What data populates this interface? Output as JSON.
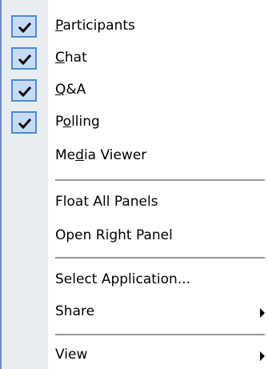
{
  "menu": {
    "colors": {
      "gutter": "#e9ecf1",
      "gutter_edge": "#6d92bd",
      "check_fill": "#c6dcf6",
      "check_border": "#4e8ad2",
      "separator": "#9a9a9a"
    },
    "items": [
      {
        "pre": "",
        "mnemonic": "P",
        "post": "articipants",
        "checked": true,
        "icon": "checkmark-icon"
      },
      {
        "pre": "",
        "mnemonic": "C",
        "post": "hat",
        "checked": true,
        "icon": "checkmark-icon"
      },
      {
        "pre": "",
        "mnemonic": "Q",
        "post": "&A",
        "checked": true,
        "icon": "checkmark-icon"
      },
      {
        "pre": "P",
        "mnemonic": "o",
        "post": "lling",
        "checked": true,
        "icon": "checkmark-icon"
      },
      {
        "pre": "Me",
        "mnemonic": "d",
        "post": "ia Viewer",
        "checked": false
      },
      {
        "pre": "Float All Panels",
        "mnemonic": "",
        "post": ""
      },
      {
        "pre": "Open Right Panel",
        "mnemonic": "",
        "post": ""
      },
      {
        "pre": "Select Application...",
        "mnemonic": "",
        "post": ""
      },
      {
        "pre": "Share",
        "mnemonic": "",
        "post": "",
        "submenu_icon": "submenu-arrow-icon"
      },
      {
        "pre": "View",
        "mnemonic": "",
        "post": "",
        "submenu_icon": "submenu-arrow-icon"
      }
    ]
  }
}
